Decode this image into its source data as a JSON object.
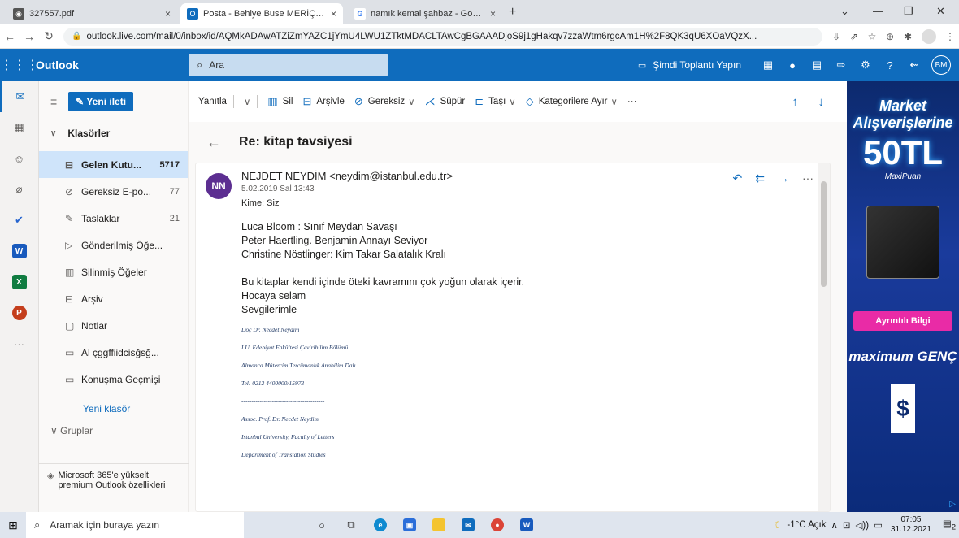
{
  "browser": {
    "tabs": [
      {
        "label": "327557.pdf",
        "close": "×"
      },
      {
        "label": "Posta - Behiye Buse MERİÇ - Out",
        "close": "×"
      },
      {
        "label": "namık kemal şahbaz - Google'da",
        "close": "×"
      }
    ],
    "new_tab": "+",
    "url": "outlook.live.com/mail/0/inbox/id/AQMkADAwATZiZmYAZC1jYmU4LWU1ZTktMDACLTAwCgBGAAADjoS9j1gHakqv7zzaWtm6rgcAm1H%2F8QK3qU6XOaVQzX..."
  },
  "outlook": {
    "brand": "Outlook",
    "search_placeholder": "Ara",
    "meet_now": "Şimdi Toplantı Yapın",
    "user_initials": "BM",
    "new_mail": "Yeni ileti",
    "folders_header": "Klasörler",
    "folders": [
      {
        "label": "Gelen Kutu...",
        "count": "5717",
        "icon": "inbox-icon"
      },
      {
        "label": "Gereksiz E-po...",
        "count": "77",
        "icon": "junk-icon"
      },
      {
        "label": "Taslaklar",
        "count": "21",
        "icon": "drafts-icon"
      },
      {
        "label": "Gönderilmiş Öğe...",
        "count": "",
        "icon": "sent-icon"
      },
      {
        "label": "Silinmiş Öğeler",
        "count": "",
        "icon": "trash-icon"
      },
      {
        "label": "Arşiv",
        "count": "",
        "icon": "archive-icon"
      },
      {
        "label": "Notlar",
        "count": "",
        "icon": "notes-icon"
      },
      {
        "label": "Al çggffiidcisğsğ...",
        "count": "",
        "icon": "folder-icon"
      },
      {
        "label": "Konuşma Geçmişi",
        "count": "",
        "icon": "folder-icon"
      }
    ],
    "new_folder": "Yeni klasör",
    "groups_header": "Gruplar",
    "promo": "Microsoft 365'e yükselt premium Outlook özellikleri",
    "toolbar": {
      "reply": "Yanıtla",
      "delete": "Sil",
      "archive": "Arşivle",
      "junk": "Gereksiz",
      "sweep": "Süpür",
      "move": "Taşı",
      "categorize": "Kategorilere Ayır",
      "more": "···"
    },
    "message": {
      "subject": "Re: kitap tavsiyesi",
      "avatar": "NN",
      "sender": "NEJDET NEYDİM <neydim@istanbul.edu.tr>",
      "date": "5.02.2019 Sal 13:43",
      "to": "Kime:  Siz",
      "body_lines": [
        "Luca Bloom : Sınıf Meydan Savaşı",
        "Peter Haertling. Benjamin Annayı Seviyor",
        "Christine Nöstlinger: Kim Takar Salatalık  Kralı",
        "",
        "Bu kitaplar kendi içinde öteki kavramını çok yoğun olarak içerir.",
        "Hocaya selam",
        "Sevgilerimle"
      ],
      "signature": [
        "Doç Dr. Necdet Neydim",
        "İ.Ü. Edebiyat Fakültesi Çeviribilim Bölümü",
        "Almanca Mütercim Tercümanlık Anabilim Dalı",
        "Tel: 0212 4400000/15973",
        "-----------------------------------------",
        "Assoc. Prof. Dr. Necdet Neydim",
        "Istanbul University, Faculty of Letters",
        "Department of Translation Studies"
      ]
    }
  },
  "ad": {
    "line1": "Market Alışverişlerine",
    "line2": "50TL",
    "line3": "MaxiPuan",
    "button": "Ayrıntılı Bilgi",
    "brand": "maximum GENÇ"
  },
  "taskbar": {
    "search": "Aramak için buraya yazın",
    "weather": "-1°C  Açık",
    "time": "07:05",
    "date": "31.12.2021",
    "notif_count": "2"
  }
}
